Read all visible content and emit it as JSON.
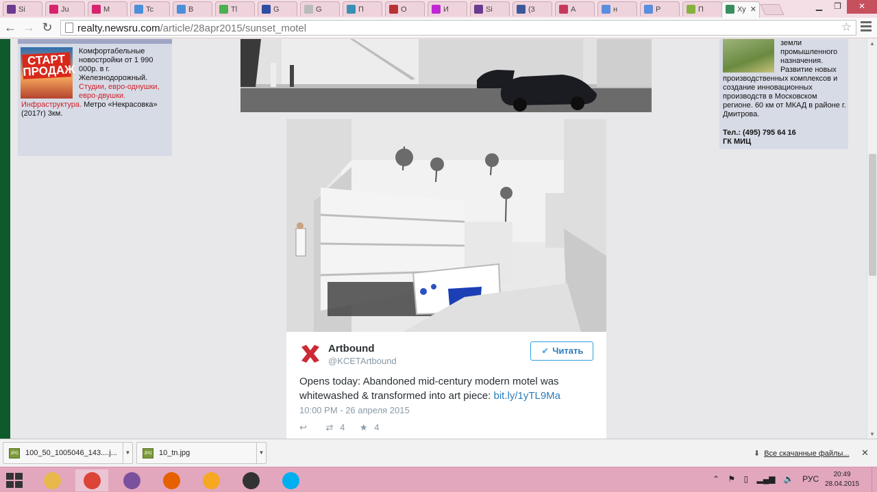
{
  "browser": {
    "tabs": [
      {
        "label": "Si",
        "icon": "flask-icon",
        "color": "#6b3b8f"
      },
      {
        "label": "Ju",
        "icon": "seven-icon",
        "color": "#d6246e"
      },
      {
        "label": "M",
        "icon": "seven-icon",
        "color": "#d6246e"
      },
      {
        "label": "Tc",
        "icon": "blocks-icon",
        "color": "#4a90d9"
      },
      {
        "label": "B",
        "icon": "blocks-icon",
        "color": "#4a90d9"
      },
      {
        "label": "Tl",
        "icon": "seven-icon",
        "color": "#4caf50"
      },
      {
        "label": "G",
        "icon": "flag-icon",
        "color": "#2e4ea3"
      },
      {
        "label": "G",
        "icon": "page-icon",
        "color": "#bbbbbb"
      },
      {
        "label": "П",
        "icon": "chart-icon",
        "color": "#3a8fb7"
      },
      {
        "label": "О",
        "icon": "omega-icon",
        "color": "#b83232"
      },
      {
        "label": "И",
        "icon": "nt-icon",
        "color": "#c026d3"
      },
      {
        "label": "Si",
        "icon": "flask-icon",
        "color": "#6b3b8f"
      },
      {
        "label": "(3",
        "icon": "facebook-icon",
        "color": "#3b5998"
      },
      {
        "label": "A",
        "icon": "arrow-icon",
        "color": "#c43a5d"
      },
      {
        "label": "н",
        "icon": "g8-icon",
        "color": "#5a8ede"
      },
      {
        "label": "Р",
        "icon": "g8-icon",
        "color": "#5a8ede"
      },
      {
        "label": "П",
        "icon": "shopify-icon",
        "color": "#86b13e"
      },
      {
        "label": "Ху",
        "icon": "page-icon",
        "color": "#3a8d5f",
        "active": true
      }
    ],
    "url_host": "realty.newsru.com",
    "url_path": "/article/28apr2015/sunset_motel"
  },
  "ad_left": {
    "stamp": "СТАРТ ПРОДАЖ",
    "text_black": "Комфортабельные новостройки от 1 990 000р. в г. Железнодорожный.",
    "text_red": "Студии, евро-однушки, евро-двушки. Инфраструктура.",
    "text_tail": "Метро «Некрасовка» (2017г) 3км."
  },
  "ad_right": {
    "text": "земли промышленного назначения. Развитие новых производственных комплексов и создание инновационных производств в Московском регионе. 60 км от МКАД в районе г. Дмитрова.",
    "phone": "Тел.: (495) 795 64 16",
    "company": "ГК МИЦ"
  },
  "tweet": {
    "name": "Artbound",
    "handle": "@KCETArtbound",
    "follow_label": "Читать",
    "text": "Opens today: Abandoned mid-century modern motel was whitewashed & transformed into art piece:",
    "link": "bit.ly/1yTL9Ma",
    "date": "10:00 PM - 26 апреля 2015",
    "retweets": "4",
    "favorites": "4",
    "accent": "#55acee"
  },
  "downloads": {
    "items": [
      {
        "name": "100_50_1005046_143....j..."
      },
      {
        "name": "10_tn.jpg"
      }
    ],
    "type_label": "JPG",
    "all_label": "Все скачанные файлы..."
  },
  "taskbar": {
    "apps": [
      {
        "name": "explorer",
        "color": "#e8b84a"
      },
      {
        "name": "chrome",
        "color": "#db4437",
        "active": true
      },
      {
        "name": "viber",
        "color": "#7b519d"
      },
      {
        "name": "firefox",
        "color": "#e66000"
      },
      {
        "name": "weather",
        "color": "#f7a823"
      },
      {
        "name": "camera",
        "color": "#333333"
      },
      {
        "name": "skype",
        "color": "#00aff0"
      }
    ],
    "lang": "РУС",
    "time": "20:49",
    "date": "28.04.2015"
  }
}
